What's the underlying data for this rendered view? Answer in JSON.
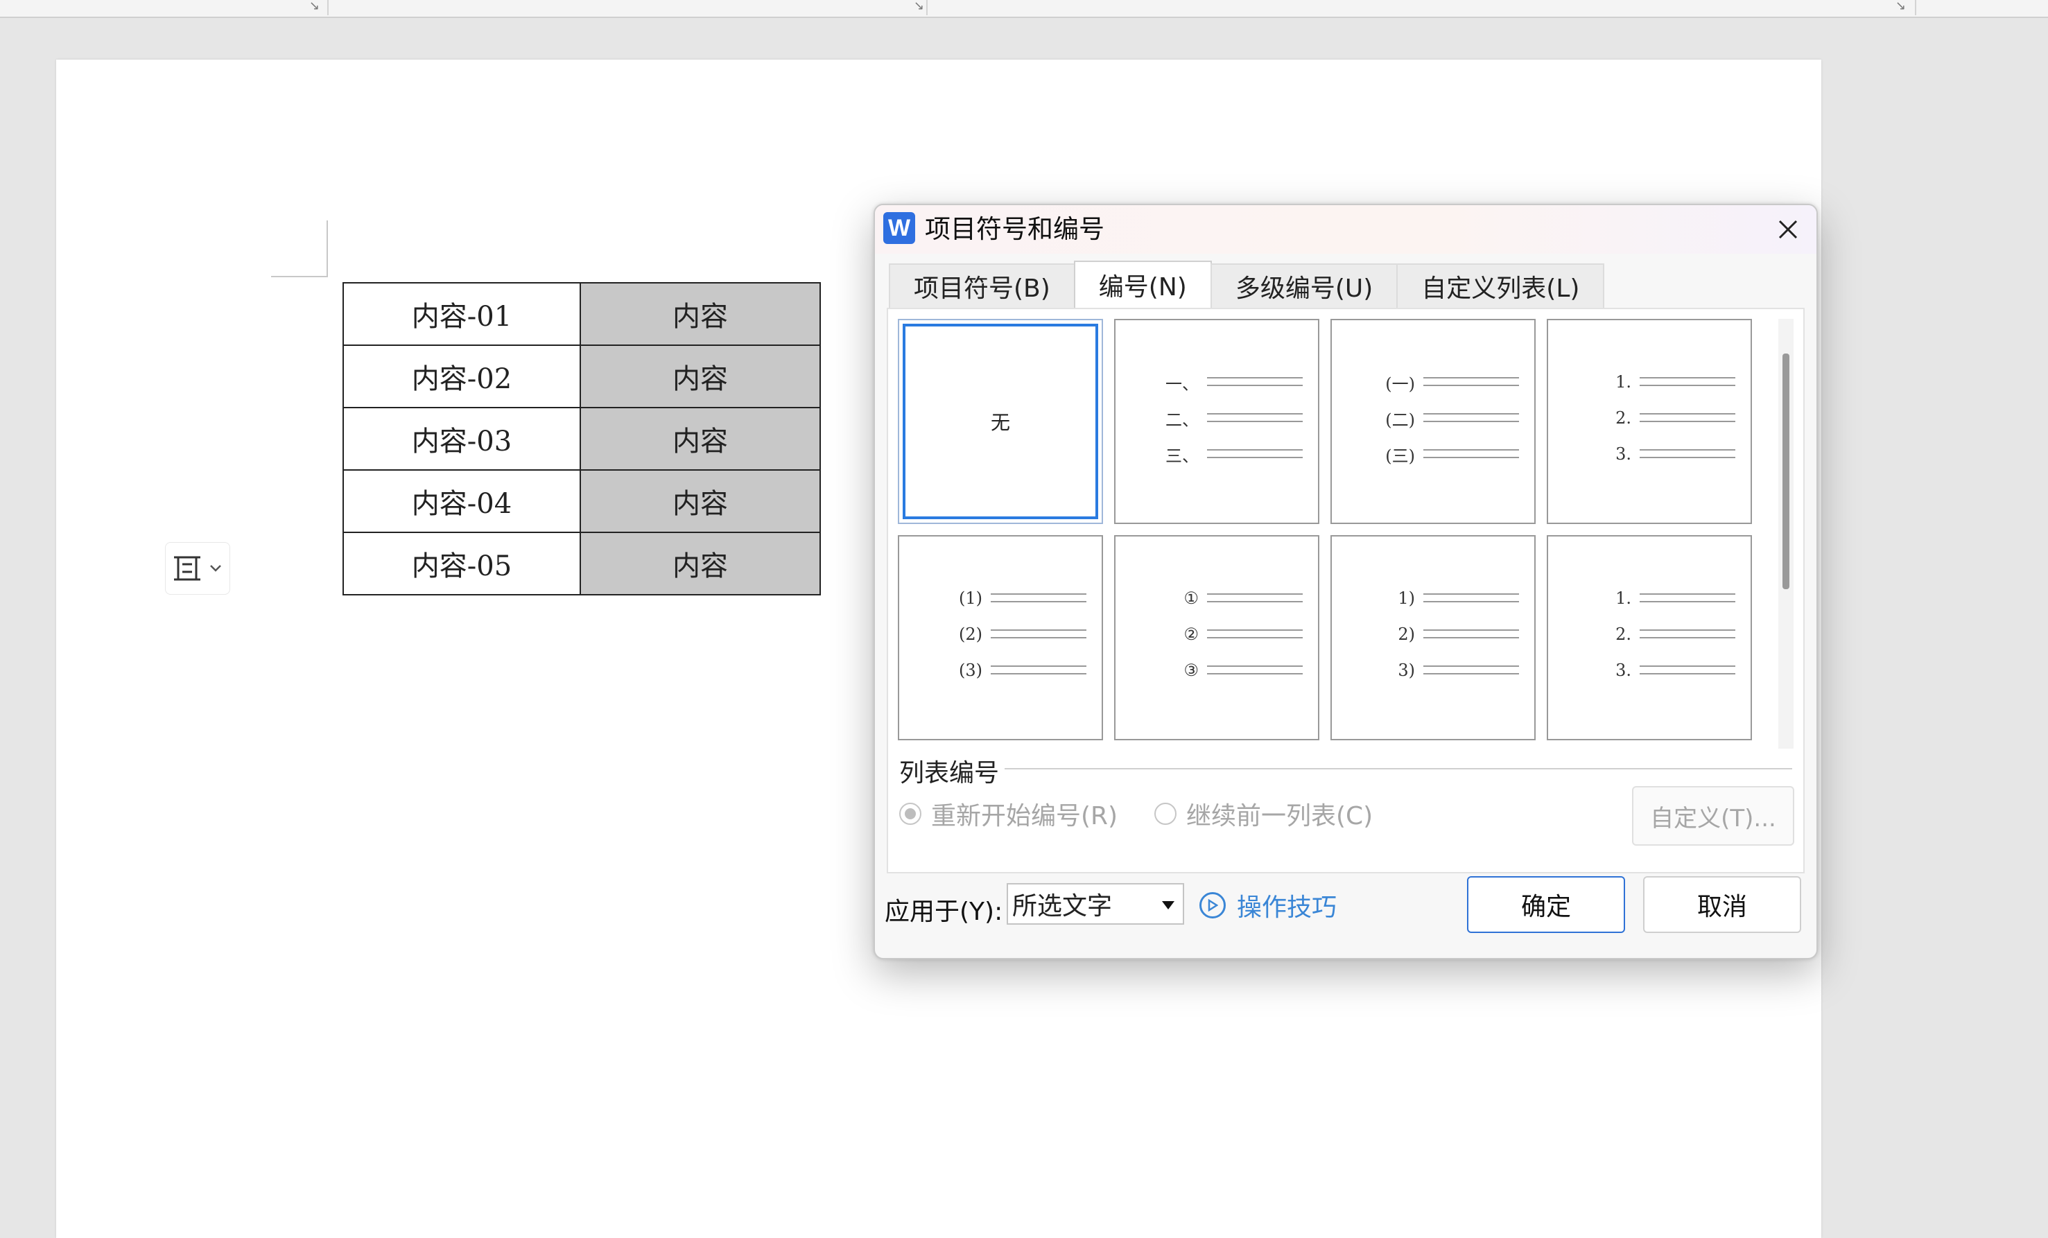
{
  "document": {
    "table_rows": [
      {
        "col1": "内容-01",
        "col2": "内容"
      },
      {
        "col1": "内容-02",
        "col2": "内容"
      },
      {
        "col1": "内容-03",
        "col2": "内容"
      },
      {
        "col1": "内容-04",
        "col2": "内容"
      },
      {
        "col1": "内容-05",
        "col2": "内容"
      }
    ],
    "shaded_column_color": "#c8c8c8"
  },
  "dialog": {
    "title": "项目符号和编号",
    "logo_text": "W",
    "tabs": [
      {
        "label": "项目符号(B)",
        "active": false
      },
      {
        "label": "编号(N)",
        "active": true
      },
      {
        "label": "多级编号(U)",
        "active": false
      },
      {
        "label": "自定义列表(L)",
        "active": false
      }
    ],
    "formats": [
      {
        "id": "none",
        "none_label": "无",
        "selected": true,
        "items": []
      },
      {
        "id": "chinese",
        "items": [
          "一、",
          "二、",
          "三、"
        ]
      },
      {
        "id": "paren-chinese",
        "items": [
          "(一)",
          "(二)",
          "(三)"
        ]
      },
      {
        "id": "decimal-dot",
        "items": [
          "1.",
          "2.",
          "3."
        ]
      },
      {
        "id": "paren-decimal",
        "items": [
          "(1)",
          "(2)",
          "(3)"
        ]
      },
      {
        "id": "circled",
        "items": [
          "①",
          "②",
          "③"
        ]
      },
      {
        "id": "decimal-paren",
        "items": [
          "1)",
          "2)",
          "3)"
        ]
      },
      {
        "id": "decimal-dot-centered",
        "items": [
          "1.",
          "2.",
          "3."
        ]
      }
    ],
    "section_label": "列表编号",
    "restart_label": "重新开始编号(R)",
    "continue_label": "继续前一列表(C)",
    "custom_button": "自定义(T)...",
    "apply_label": "应用于(Y):",
    "apply_value": "所选文字",
    "tips_label": "操作技巧",
    "ok_label": "确定",
    "cancel_label": "取消",
    "accent_color": "#2a7be0",
    "link_color": "#3a86d6"
  }
}
